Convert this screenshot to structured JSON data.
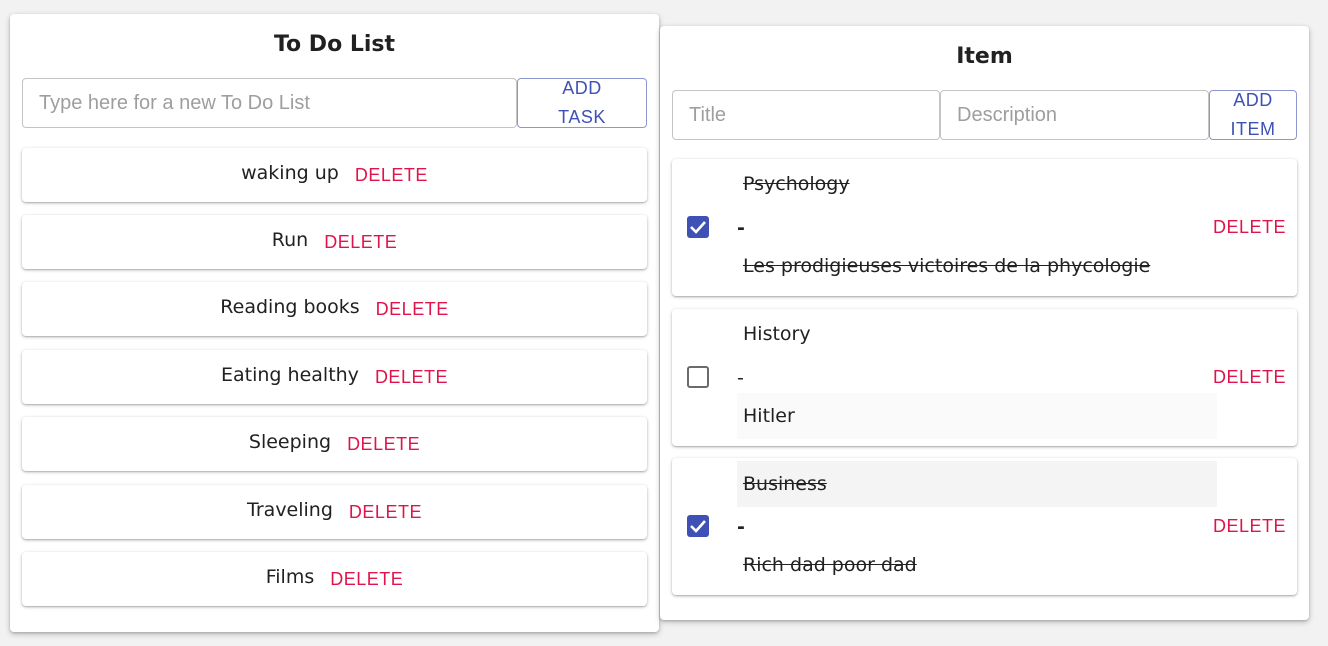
{
  "todo": {
    "title": "To Do List",
    "input_placeholder": "Type here for a new To Do List",
    "add_label": "ADD TASK",
    "delete_label": "DELETE",
    "tasks": [
      {
        "label": "waking up"
      },
      {
        "label": "Run"
      },
      {
        "label": "Reading books"
      },
      {
        "label": "Eating healthy"
      },
      {
        "label": "Sleeping"
      },
      {
        "label": "Traveling"
      },
      {
        "label": "Films"
      }
    ]
  },
  "item": {
    "title": "Item",
    "title_placeholder": "Title",
    "description_placeholder": "Description",
    "add_label": "ADD ITEM",
    "delete_label": "DELETE",
    "separator": "-",
    "items": [
      {
        "title": "Psychology",
        "description": "Les prodigieuses victoires de la phycologie",
        "checked": true
      },
      {
        "title": "History",
        "description": "Hitler",
        "checked": false
      },
      {
        "title": "Business",
        "description": "Rich dad poor dad",
        "checked": true
      }
    ]
  },
  "colors": {
    "primary": "#3f51b5",
    "danger": "#e0144c",
    "background": "#f2f2f2"
  }
}
